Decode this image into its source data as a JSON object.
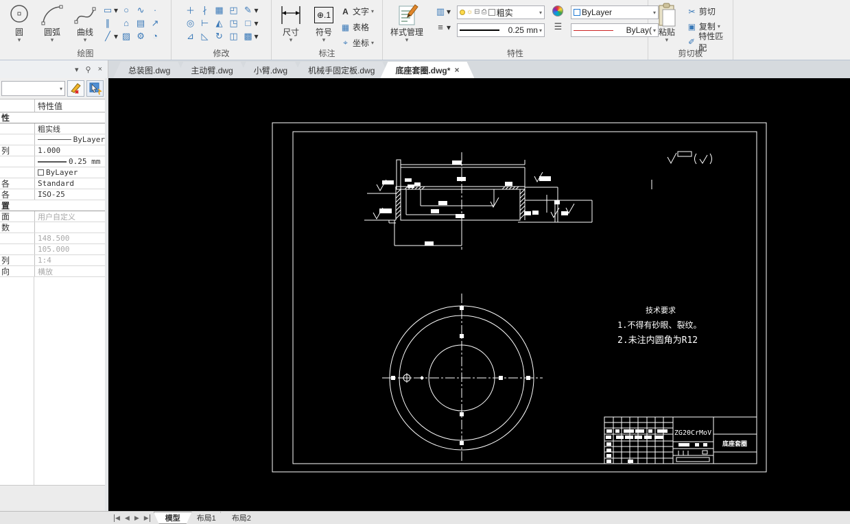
{
  "ribbon": {
    "groups": {
      "draw": "绘图",
      "modify": "修改",
      "annotate": "标注",
      "properties": "特性",
      "clipboard": "剪切板"
    },
    "draw_buttons": [
      {
        "label": "圆"
      },
      {
        "label": "圆弧"
      },
      {
        "label": "曲线"
      }
    ],
    "draw_grid": [
      {
        "name": "rectangle",
        "glyph": "▭",
        "drop": true
      },
      {
        "name": "ellipse",
        "glyph": "○"
      },
      {
        "name": "spline",
        "glyph": "∿"
      },
      {
        "name": "point",
        "glyph": "·"
      },
      {
        "name": "parallel-lines",
        "glyph": "∥"
      },
      {
        "name": "profile",
        "glyph": "⌂"
      },
      {
        "name": "bolt",
        "glyph": "▤"
      },
      {
        "name": "arrow",
        "glyph": "↗"
      },
      {
        "name": "line",
        "glyph": "╱",
        "drop": true
      },
      {
        "name": "hatch",
        "glyph": "▨"
      },
      {
        "name": "gear",
        "glyph": "⚙"
      },
      {
        "name": "arc-text",
        "glyph": "◔"
      }
    ],
    "modify_grid": [
      {
        "name": "move",
        "glyph": "＋"
      },
      {
        "name": "trim",
        "glyph": "∤"
      },
      {
        "name": "array",
        "glyph": "▦"
      },
      {
        "name": "copy-object",
        "glyph": "◰"
      },
      {
        "name": "erase",
        "glyph": "✎",
        "drop": true
      },
      {
        "name": "offset",
        "glyph": "◎"
      },
      {
        "name": "break",
        "glyph": "⊢"
      },
      {
        "name": "mirror",
        "glyph": "◭"
      },
      {
        "name": "corner",
        "glyph": "◳"
      },
      {
        "name": "rectangle-edit",
        "glyph": "□",
        "drop": true
      },
      {
        "name": "stretch",
        "glyph": "⊿"
      },
      {
        "name": "taper",
        "glyph": "◺"
      },
      {
        "name": "rotate",
        "glyph": "↻"
      },
      {
        "name": "rotate-3d",
        "glyph": "◫"
      },
      {
        "name": "hatch-edit",
        "glyph": "▩",
        "drop": true
      }
    ],
    "dimension_label": "尺寸",
    "symbol_label": "符号",
    "annotate_small": [
      {
        "name": "text",
        "icon": "A",
        "label": "文字",
        "drop": true
      },
      {
        "name": "table",
        "icon": "▦",
        "label": "表格",
        "drop": false
      },
      {
        "name": "coordinate",
        "icon": "⌖",
        "label": "坐标",
        "drop": true
      }
    ],
    "style_manager_label": "样式管理",
    "layer_combo_value": "粗实",
    "lineweight_combo_value": "0.25 mn",
    "color_combo_value": "ByLayer",
    "linetype_combo_value": "ByLay(",
    "paste_label": "粘贴",
    "clip_items": [
      {
        "name": "cut",
        "icon": "✂",
        "label": "剪切",
        "drop": false
      },
      {
        "name": "copy",
        "icon": "▣",
        "label": "复制",
        "drop": true
      },
      {
        "name": "match-properties",
        "icon": "✐",
        "label": "特性匹配",
        "drop": false
      }
    ]
  },
  "doc_tabs": [
    {
      "label": "总装图.dwg",
      "active": false
    },
    {
      "label": "主动臂.dwg",
      "active": false
    },
    {
      "label": "小臂.dwg",
      "active": false
    },
    {
      "label": "机械手固定板.dwg",
      "active": false
    },
    {
      "label": "底座套圈.dwg*",
      "active": true
    }
  ],
  "panel": {
    "value_header": "特性值",
    "rows": [
      {
        "label": "性",
        "value": "",
        "section": true
      },
      {
        "label": "",
        "value": "粗实线",
        "type": "text"
      },
      {
        "label": "",
        "value": "ByLayer",
        "type": "linetype"
      },
      {
        "label": "列",
        "value": "1.000",
        "type": "text"
      },
      {
        "label": "",
        "value": "0.25 mm",
        "type": "lineweight"
      },
      {
        "label": "",
        "value": "ByLayer",
        "type": "colorbox"
      },
      {
        "label": "各",
        "value": "Standard",
        "type": "text"
      },
      {
        "label": "各",
        "value": "ISO-25",
        "type": "text"
      },
      {
        "label": "置",
        "value": "",
        "section": true
      },
      {
        "label": "面",
        "value": "用户自定义",
        "type": "text",
        "muted": true
      },
      {
        "label": "数",
        "value": "",
        "type": "text",
        "muted": true
      },
      {
        "label": "",
        "value": "148.500",
        "type": "text",
        "muted": true
      },
      {
        "label": "",
        "value": "105.000",
        "type": "text",
        "muted": true
      },
      {
        "label": "列",
        "value": "1:4",
        "type": "text",
        "muted": true
      },
      {
        "label": "向",
        "value": "横放",
        "type": "text",
        "muted": true
      }
    ]
  },
  "canvas": {
    "tech_requirements": {
      "title": "技术要求",
      "line1": "1.不得有砂眼、裂纹。",
      "line2": "2.未注内圆角为R12"
    },
    "title_block": {
      "material": "ZG20CrMoV",
      "part_name": "底座套圈"
    }
  },
  "layout_tabs": [
    {
      "label": "模型",
      "active": true
    },
    {
      "label": "布局1",
      "active": false
    },
    {
      "label": "布局2",
      "active": false
    }
  ],
  "icons": {
    "close": "×",
    "dropdown": "▾",
    "pin": "⚲",
    "sun": "☼",
    "lock": "⊟",
    "printer": "⎙",
    "menu": "≡",
    "nav_prev": "◀",
    "nav_next": "▶",
    "symbol_glyph": "⊕.1"
  }
}
